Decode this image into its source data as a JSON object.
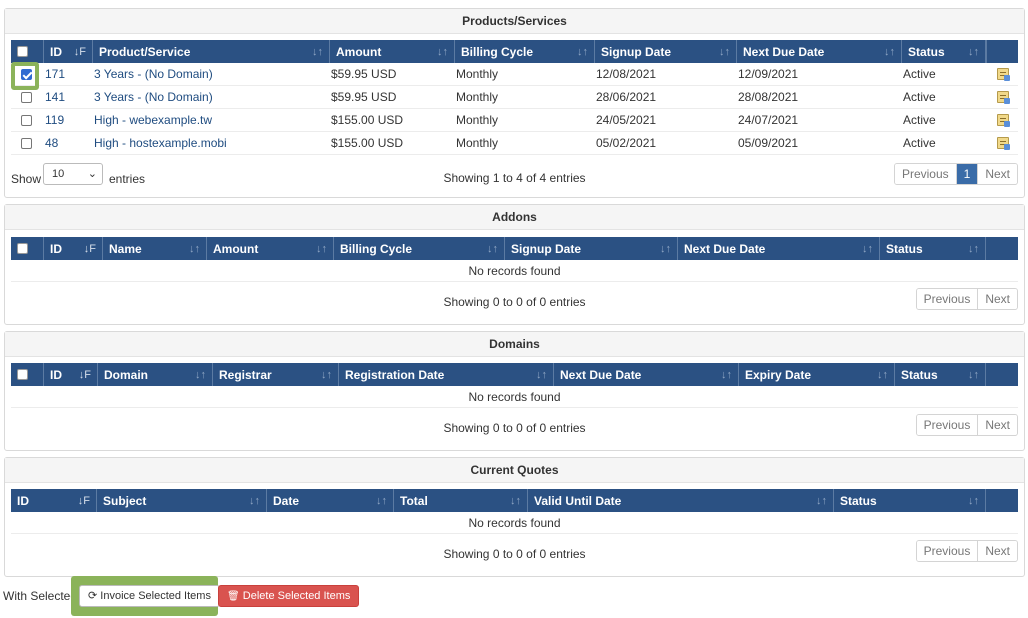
{
  "products": {
    "title": "Products/Services",
    "headers": [
      "ID",
      "Product/Service",
      "Amount",
      "Billing Cycle",
      "Signup Date",
      "Next Due Date",
      "Status"
    ],
    "rows": [
      {
        "id": "171",
        "product": "3 Years - (No Domain)",
        "amount": "$59.95 USD",
        "cycle": "Monthly",
        "signup": "12/08/2021",
        "next_due": "12/09/2021",
        "status": "Active",
        "checked": true
      },
      {
        "id": "141",
        "product": "3 Years - (No Domain)",
        "amount": "$59.95 USD",
        "cycle": "Monthly",
        "signup": "28/06/2021",
        "next_due": "28/08/2021",
        "status": "Active",
        "checked": false
      },
      {
        "id": "119",
        "product": "High - webexample.tw",
        "amount": "$155.00 USD",
        "cycle": "Monthly",
        "signup": "24/05/2021",
        "next_due": "24/07/2021",
        "status": "Active",
        "checked": false
      },
      {
        "id": "48",
        "product": "High - hostexample.mobi",
        "amount": "$155.00 USD",
        "cycle": "Monthly",
        "signup": "05/02/2021",
        "next_due": "05/09/2021",
        "status": "Active",
        "checked": false
      }
    ],
    "show_label": "Show",
    "page_size": "10",
    "entries_label": "entries",
    "info": "Showing 1 to 4 of 4 entries",
    "pager": {
      "previous": "Previous",
      "page": "1",
      "next": "Next"
    }
  },
  "addons": {
    "title": "Addons",
    "headers": [
      "ID",
      "Name",
      "Amount",
      "Billing Cycle",
      "Signup Date",
      "Next Due Date",
      "Status"
    ],
    "empty": "No records found",
    "info": "Showing 0 to 0 of 0 entries",
    "pager": {
      "previous": "Previous",
      "next": "Next"
    }
  },
  "domains": {
    "title": "Domains",
    "headers": [
      "ID",
      "Domain",
      "Registrar",
      "Registration Date",
      "Next Due Date",
      "Expiry Date",
      "Status"
    ],
    "empty": "No records found",
    "info": "Showing 0 to 0 of 0 entries",
    "pager": {
      "previous": "Previous",
      "next": "Next"
    }
  },
  "quotes": {
    "title": "Current Quotes",
    "headers": [
      "ID",
      "Subject",
      "Date",
      "Total",
      "Valid Until Date",
      "Status"
    ],
    "empty": "No records found",
    "info": "Showing 0 to 0 of 0 entries",
    "pager": {
      "previous": "Previous",
      "next": "Next"
    }
  },
  "actions": {
    "with_selected": "With Selected:",
    "invoice": "Invoice Selected Items",
    "delete": "Delete Selected Items"
  },
  "colors": {
    "header_bg": "#2b5183",
    "highlight": "#8bb35a",
    "danger": "#d9534f",
    "pager_active": "#3a6ca8"
  },
  "icons": [
    "sort-icon",
    "notes-icon",
    "refresh-icon",
    "trash-icon",
    "chevron-down-icon"
  ]
}
